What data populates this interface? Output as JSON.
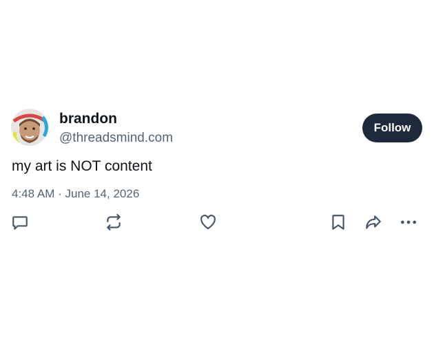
{
  "post": {
    "author": {
      "name": "brandon",
      "handle": "@threadsmind.com"
    },
    "follow_label": "Follow",
    "text": "my art is NOT content",
    "time": "4:48 AM",
    "separator": "·",
    "date": "June 14, 2026"
  },
  "actions": {
    "reply": "reply-icon",
    "repost": "repost-icon",
    "like": "heart-icon",
    "bookmark": "bookmark-icon",
    "share": "share-icon",
    "more": "more-icon"
  },
  "colors": {
    "follow_bg": "#1e293b",
    "follow_text": "#ffffff",
    "secondary_text": "#536471",
    "icon": "#475569"
  }
}
